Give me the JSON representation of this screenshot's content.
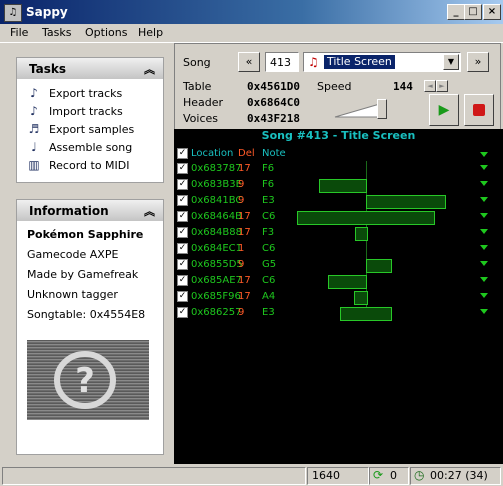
{
  "window": {
    "title": "Sappy",
    "app_icon": "music-icon"
  },
  "menu": [
    "File",
    "Tasks",
    "Options",
    "Help"
  ],
  "tasks_panel": {
    "title": "Tasks",
    "items": [
      {
        "label": "Export tracks",
        "icon": "export-tracks-icon"
      },
      {
        "label": "Import tracks",
        "icon": "import-tracks-icon"
      },
      {
        "label": "Export samples",
        "icon": "export-samples-icon"
      },
      {
        "label": "Assemble song",
        "icon": "assemble-song-icon"
      },
      {
        "label": "Record to MIDI",
        "icon": "record-midi-icon"
      }
    ]
  },
  "info_panel": {
    "title": "Information",
    "game_title": "Pokémon Sapphire",
    "gamecode": "Gamecode AXPE",
    "maker": "Made by Gamefreak",
    "tagger": "Unknown tagger",
    "songtable": "Songtable: 0x4554E8"
  },
  "controls": {
    "song_label": "Song",
    "prev_label": "«",
    "next_label": "»",
    "song_number": "413",
    "song_name": "Title Screen",
    "table_label": "Table",
    "table_value": "0x4561D0",
    "header_label": "Header",
    "header_value": "0x6864C0",
    "voices_label": "Voices",
    "voices_value": "0x43F218",
    "speed_label": "Speed",
    "speed_value": "144"
  },
  "song_header": "Song #413 - Title Screen",
  "columns": {
    "location": "Location",
    "del": "Del",
    "note": "Note"
  },
  "tracks": [
    {
      "location": "0x683787",
      "del": "17",
      "note": "F6"
    },
    {
      "location": "0x683B3E",
      "del": "9",
      "note": "F6"
    },
    {
      "location": "0x6841BC",
      "del": "9",
      "note": "E3"
    },
    {
      "location": "0x68464B",
      "del": "17",
      "note": "C6"
    },
    {
      "location": "0x684B88",
      "del": "17",
      "note": "F3"
    },
    {
      "location": "0x684EC1",
      "del": "1",
      "note": "C6"
    },
    {
      "location": "0x6855D5",
      "del": "9",
      "note": "G5"
    },
    {
      "location": "0x685AE7",
      "del": "17",
      "note": "C6"
    },
    {
      "location": "0x685F96",
      "del": "17",
      "note": "A4"
    },
    {
      "location": "0x686257",
      "del": "9",
      "note": "E3"
    }
  ],
  "status": {
    "value1": "1640",
    "loops": "0",
    "time": "00:27 (34)"
  }
}
